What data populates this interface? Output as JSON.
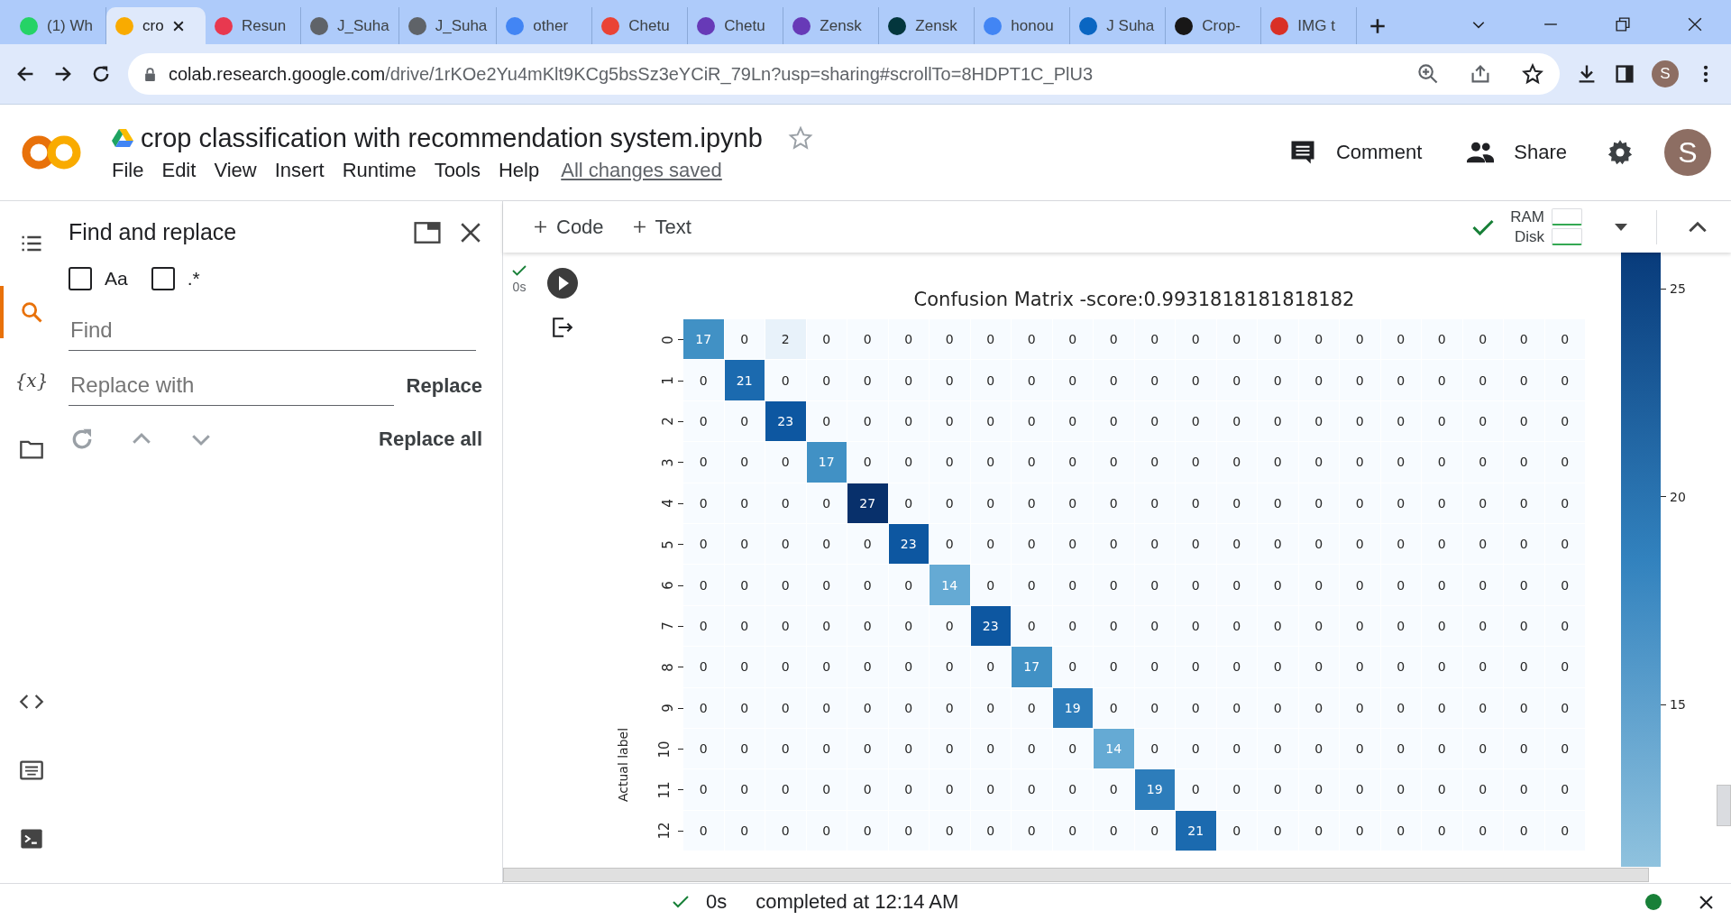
{
  "browser": {
    "tabs": [
      {
        "label": "(1) Wh",
        "selected": false,
        "color": "#25d366"
      },
      {
        "label": "cro",
        "selected": true,
        "color": "#f9ab00"
      },
      {
        "label": "Resun",
        "selected": false,
        "color": "#e8384f"
      },
      {
        "label": "J_Suha",
        "selected": false,
        "color": "#5f6368"
      },
      {
        "label": "J_Suha",
        "selected": false,
        "color": "#5f6368"
      },
      {
        "label": "other",
        "selected": false,
        "color": "#4285f4"
      },
      {
        "label": "Chetu",
        "selected": false,
        "color": "#ea4335"
      },
      {
        "label": "Chetu",
        "selected": false,
        "color": "#673ab7"
      },
      {
        "label": "Zensk",
        "selected": false,
        "color": "#673ab7"
      },
      {
        "label": "Zensk",
        "selected": false,
        "color": "#03363d"
      },
      {
        "label": "honou",
        "selected": false,
        "color": "#4285f4"
      },
      {
        "label": "J Suha",
        "selected": false,
        "color": "#0a66c2"
      },
      {
        "label": "Crop-",
        "selected": false,
        "color": "#181717"
      },
      {
        "label": "IMG t",
        "selected": false,
        "color": "#d93025"
      }
    ],
    "address": {
      "host": "colab.research.google.com",
      "path": "/drive/1rKOe2Yu4mKlt9KCg5bsSz3eYCiR_79Ln?usp=sharing#scrollTo=8HDPT1C_PlU3"
    },
    "profile": "S"
  },
  "header": {
    "title": "crop classification with recommendation system.ipynb",
    "starred": false,
    "menu": [
      "File",
      "Edit",
      "View",
      "Insert",
      "Runtime",
      "Tools",
      "Help"
    ],
    "save_status": "All changes saved",
    "comment": "Comment",
    "share": "Share",
    "avatar": "S"
  },
  "rail": [
    {
      "kind": "toc",
      "selected": false
    },
    {
      "kind": "search",
      "selected": true
    },
    {
      "kind": "variables",
      "label": "{x}",
      "selected": false
    },
    {
      "kind": "files",
      "selected": false
    }
  ],
  "rail_bottom": [
    {
      "kind": "code"
    },
    {
      "kind": "palette"
    },
    {
      "kind": "terminal"
    }
  ],
  "find_panel": {
    "title": "Find and replace",
    "options": [
      {
        "label": "Aa",
        "checked": false
      },
      {
        "label": ".*",
        "checked": false
      }
    ],
    "find_placeholder": "Find",
    "replace_placeholder": "Replace with",
    "replace": "Replace",
    "replace_all": "Replace all"
  },
  "toolbar": {
    "add": [
      "Code",
      "Text"
    ],
    "resources": [
      "RAM",
      "Disk"
    ]
  },
  "cell": {
    "exec_time": "0s",
    "output": {
      "title": "Confusion Matrix -score:0.9931818181818182",
      "ylabel": "Actual label",
      "rows": [
        {
          "label": "0",
          "cells": [
            "17",
            "0",
            "2",
            "0",
            "0",
            "0",
            "0",
            "0",
            "0",
            "0",
            "0",
            "0",
            "0",
            "0",
            "0",
            "0",
            "0",
            "0",
            "0",
            "0",
            "0",
            "0"
          ]
        },
        {
          "label": "1",
          "cells": [
            "0",
            "21",
            "0",
            "0",
            "0",
            "0",
            "0",
            "0",
            "0",
            "0",
            "0",
            "0",
            "0",
            "0",
            "0",
            "0",
            "0",
            "0",
            "0",
            "0",
            "0",
            "0"
          ]
        },
        {
          "label": "2",
          "cells": [
            "0",
            "0",
            "23",
            "0",
            "0",
            "0",
            "0",
            "0",
            "0",
            "0",
            "0",
            "0",
            "0",
            "0",
            "0",
            "0",
            "0",
            "0",
            "0",
            "0",
            "0",
            "0"
          ]
        },
        {
          "label": "3",
          "cells": [
            "0",
            "0",
            "0",
            "17",
            "0",
            "0",
            "0",
            "0",
            "0",
            "0",
            "0",
            "0",
            "0",
            "0",
            "0",
            "0",
            "0",
            "0",
            "0",
            "0",
            "0",
            "0"
          ]
        },
        {
          "label": "4",
          "cells": [
            "0",
            "0",
            "0",
            "0",
            "27",
            "0",
            "0",
            "0",
            "0",
            "0",
            "0",
            "0",
            "0",
            "0",
            "0",
            "0",
            "0",
            "0",
            "0",
            "0",
            "0",
            "0"
          ]
        },
        {
          "label": "5",
          "cells": [
            "0",
            "0",
            "0",
            "0",
            "0",
            "23",
            "0",
            "0",
            "0",
            "0",
            "0",
            "0",
            "0",
            "0",
            "0",
            "0",
            "0",
            "0",
            "0",
            "0",
            "0",
            "0"
          ]
        },
        {
          "label": "6",
          "cells": [
            "0",
            "0",
            "0",
            "0",
            "0",
            "0",
            "14",
            "0",
            "0",
            "0",
            "0",
            "0",
            "0",
            "0",
            "0",
            "0",
            "0",
            "0",
            "0",
            "0",
            "0",
            "0"
          ]
        },
        {
          "label": "7",
          "cells": [
            "0",
            "0",
            "0",
            "0",
            "0",
            "0",
            "0",
            "23",
            "0",
            "0",
            "0",
            "0",
            "0",
            "0",
            "0",
            "0",
            "0",
            "0",
            "0",
            "0",
            "0",
            "0"
          ]
        },
        {
          "label": "8",
          "cells": [
            "0",
            "0",
            "0",
            "0",
            "0",
            "0",
            "0",
            "0",
            "17",
            "0",
            "0",
            "0",
            "0",
            "0",
            "0",
            "0",
            "0",
            "0",
            "0",
            "0",
            "0",
            "0"
          ]
        },
        {
          "label": "9",
          "cells": [
            "0",
            "0",
            "0",
            "0",
            "0",
            "0",
            "0",
            "0",
            "0",
            "19",
            "0",
            "0",
            "0",
            "0",
            "0",
            "0",
            "0",
            "0",
            "0",
            "0",
            "0",
            "0"
          ]
        },
        {
          "label": "10",
          "cells": [
            "0",
            "0",
            "0",
            "0",
            "0",
            "0",
            "0",
            "0",
            "0",
            "0",
            "14",
            "0",
            "0",
            "0",
            "0",
            "0",
            "0",
            "0",
            "0",
            "0",
            "0",
            "0"
          ]
        },
        {
          "label": "11",
          "cells": [
            "0",
            "0",
            "0",
            "0",
            "0",
            "0",
            "0",
            "0",
            "0",
            "0",
            "0",
            "19",
            "0",
            "0",
            "0",
            "0",
            "0",
            "0",
            "0",
            "0",
            "0",
            "0"
          ]
        },
        {
          "label": "12",
          "cells": [
            "0",
            "0",
            "0",
            "0",
            "0",
            "0",
            "0",
            "0",
            "0",
            "0",
            "0",
            "0",
            "21",
            "0",
            "0",
            "0",
            "0",
            "0",
            "0",
            "0",
            "0",
            "0"
          ]
        }
      ],
      "colorbar_ticks": [
        "25",
        "20",
        "15"
      ]
    }
  },
  "status": {
    "time": "0s",
    "message": "completed at 12:14 AM"
  }
}
